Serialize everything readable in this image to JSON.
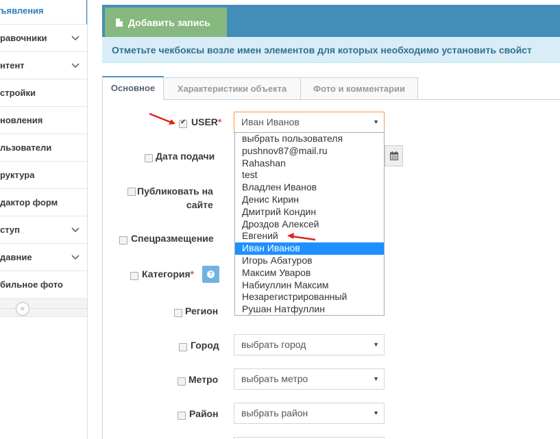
{
  "sidebar": {
    "items": [
      {
        "label": "ъявления",
        "chevron": false,
        "active": true
      },
      {
        "label": "равочники",
        "chevron": true
      },
      {
        "label": "нтент",
        "chevron": true
      },
      {
        "label": "стройки",
        "chevron": false
      },
      {
        "label": "новления",
        "chevron": false
      },
      {
        "label": "льзователи",
        "chevron": false
      },
      {
        "label": "руктура",
        "chevron": false
      },
      {
        "label": "дактор форм",
        "chevron": false
      },
      {
        "label": "ступ",
        "chevron": true
      },
      {
        "label": "давние",
        "chevron": true
      },
      {
        "label": "бильное фото",
        "chevron": false
      }
    ],
    "collapse_icon": "«"
  },
  "toolbar": {
    "add_label": "Добавить запись"
  },
  "info": {
    "text": "Отметьте чекбоксы возле имен элементов для которых необходимо установить свойст"
  },
  "tabs": [
    {
      "label": "Основное",
      "active": true
    },
    {
      "label": "Характеристики объекта"
    },
    {
      "label": "Фото и комментарии"
    }
  ],
  "form": {
    "user": {
      "label": "USER",
      "required": "*",
      "value": "Иван Иванов",
      "checked": true
    },
    "date": {
      "label": "Дата подачи"
    },
    "publish": {
      "label_line1": "Публиковать на",
      "label_line2": "сайте"
    },
    "special": {
      "label": "Спецразмещение"
    },
    "category": {
      "label": "Категория",
      "required": "*",
      "help": "?"
    },
    "region": {
      "label": "Регион"
    },
    "city": {
      "label": "Город",
      "value": "выбрать город"
    },
    "metro": {
      "label": "Метро",
      "value": "выбрать метро"
    },
    "district": {
      "label": "Район",
      "value": "выбрать район"
    }
  },
  "dropdown": {
    "options": [
      "выбрать пользователя",
      "pushnov87@mail.ru",
      "Rahashan",
      "test",
      "Владлен Иванов",
      "Денис Кирин",
      "Дмитрий Кондин",
      "Дроздов Алексей",
      "Евгений",
      "Иван Иванов",
      "Игорь Абатуров",
      "Максим Уваров",
      "Набиуллин Максим",
      "Незарегистрированный",
      "Рушан Натфуллин"
    ],
    "selected_index": 9
  },
  "colors": {
    "accent": "#438eb9",
    "add_button": "#87b87f",
    "info_bg": "#d9edf7",
    "selected_option": "#1e90ff",
    "annotation_arrow": "#e2231a"
  }
}
